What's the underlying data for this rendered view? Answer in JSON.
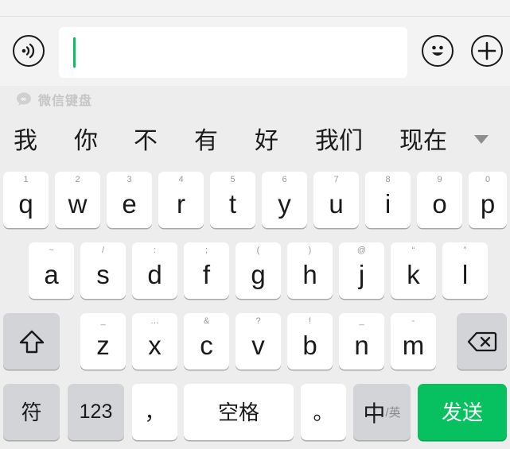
{
  "input": {
    "value": ""
  },
  "brand": {
    "label": "微信键盘"
  },
  "candidates": [
    "我",
    "你",
    "不",
    "有",
    "好",
    "我们",
    "现在"
  ],
  "rows": {
    "row1": [
      {
        "key": "q",
        "hint": "1"
      },
      {
        "key": "w",
        "hint": "2"
      },
      {
        "key": "e",
        "hint": "3"
      },
      {
        "key": "r",
        "hint": "4"
      },
      {
        "key": "t",
        "hint": "5"
      },
      {
        "key": "y",
        "hint": "6"
      },
      {
        "key": "u",
        "hint": "7"
      },
      {
        "key": "i",
        "hint": "8"
      },
      {
        "key": "o",
        "hint": "9"
      },
      {
        "key": "p",
        "hint": "0"
      }
    ],
    "row2": [
      {
        "key": "a",
        "hint": "~"
      },
      {
        "key": "s",
        "hint": "/"
      },
      {
        "key": "d",
        "hint": ":"
      },
      {
        "key": "f",
        "hint": ";"
      },
      {
        "key": "g",
        "hint": "("
      },
      {
        "key": "h",
        "hint": ")"
      },
      {
        "key": "j",
        "hint": "@"
      },
      {
        "key": "k",
        "hint": "“"
      },
      {
        "key": "l",
        "hint": "”"
      }
    ],
    "row3": [
      {
        "key": "z",
        "hint": "_"
      },
      {
        "key": "x",
        "hint": "…"
      },
      {
        "key": "c",
        "hint": "&"
      },
      {
        "key": "v",
        "hint": "?"
      },
      {
        "key": "b",
        "hint": "!"
      },
      {
        "key": "n",
        "hint": "_"
      },
      {
        "key": "m",
        "hint": "-"
      }
    ]
  },
  "bottom": {
    "symbols": "符",
    "numbers": "123",
    "comma": "，",
    "space": "空格",
    "period": "。",
    "lang_main": "中",
    "lang_sub": "/英",
    "send": "发送"
  },
  "colors": {
    "accent": "#07c160",
    "key_bg": "#ffffff",
    "func_key_bg": "#d2d4d8",
    "keyboard_bg": "#ededed"
  }
}
